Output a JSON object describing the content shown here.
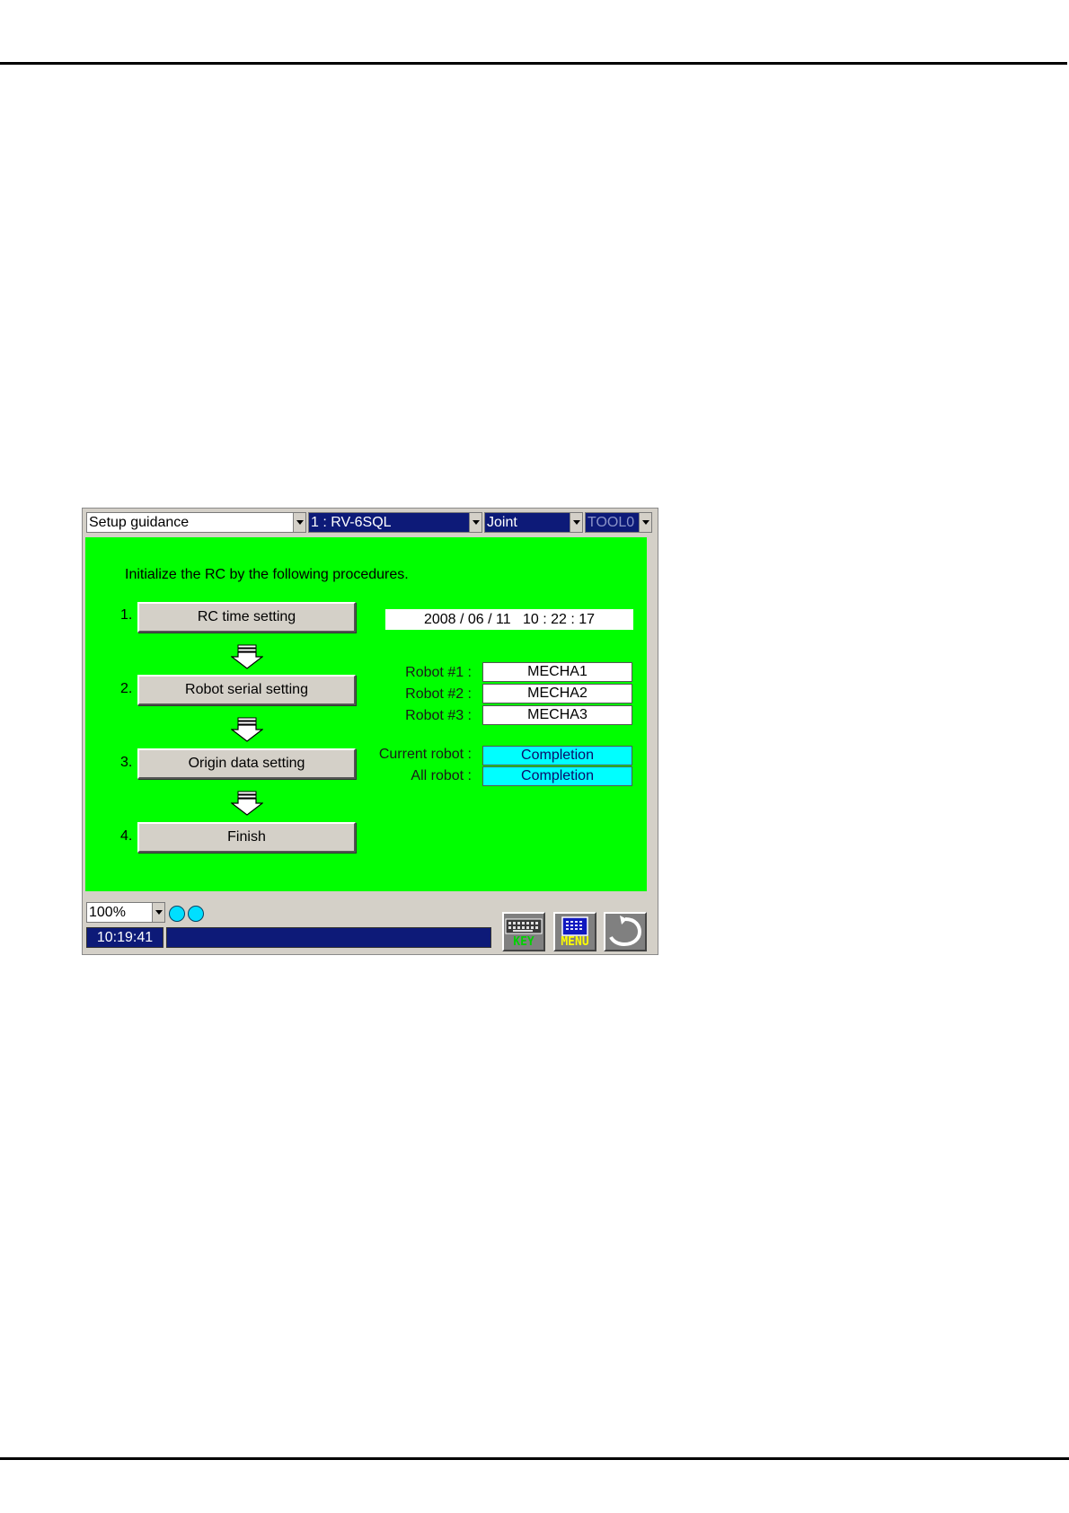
{
  "toolbar": {
    "mode_label": "Setup guidance",
    "robot_label": "1 : RV-6SQL",
    "coord_label": "Joint",
    "tool_label": "TOOL0"
  },
  "main": {
    "instruction": "Initialize the RC by the following procedures.",
    "steps": [
      {
        "num": "1.",
        "label": "RC time setting"
      },
      {
        "num": "2.",
        "label": "Robot serial setting"
      },
      {
        "num": "3.",
        "label": "Origin data setting"
      },
      {
        "num": "4.",
        "label": "Finish"
      }
    ],
    "datetime": "2008 / 06 / 11   10 : 22 : 17",
    "robots": [
      {
        "label": "Robot #1 :",
        "value": "MECHA1"
      },
      {
        "label": "Robot #2 :",
        "value": "MECHA2"
      },
      {
        "label": "Robot #3 :",
        "value": "MECHA3"
      }
    ],
    "status": [
      {
        "label": "Current robot :",
        "value": "Completion"
      },
      {
        "label": "All robot :",
        "value": "Completion"
      }
    ]
  },
  "footer": {
    "zoom": "100%",
    "time": "10:19:41",
    "key_label": "KEY",
    "menu_label": "MENU"
  },
  "colors": {
    "panel": "#00ff00",
    "navy": "#0d1a78",
    "cyan": "#00ffff"
  },
  "icons": [
    "chevron-down-icon",
    "down-arrow-icon",
    "keyboard-icon",
    "menu-icon",
    "return-icon",
    "indicator-led"
  ]
}
